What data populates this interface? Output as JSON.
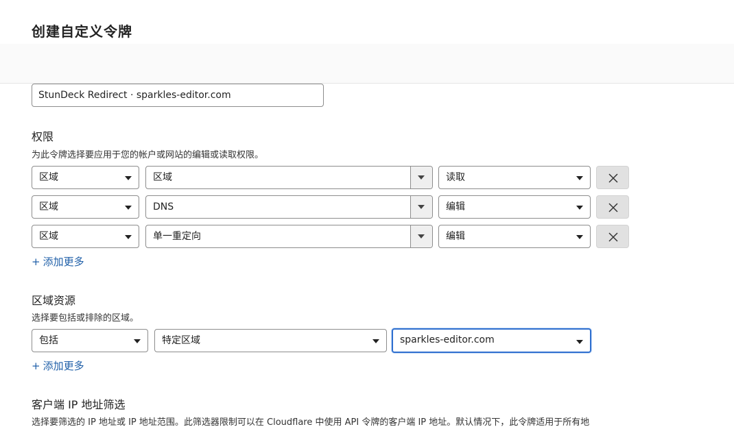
{
  "page": {
    "title": "创建自定义令牌"
  },
  "token_name": {
    "value": "StunDeck Redirect · sparkles-editor.com"
  },
  "permissions": {
    "title": "权限",
    "description": "为此令牌选择要应用于您的帐户或网站的编辑或读取权限。",
    "rows": [
      {
        "scope": "区域",
        "item": "区域",
        "access": "读取"
      },
      {
        "scope": "区域",
        "item": "DNS",
        "access": "编辑"
      },
      {
        "scope": "区域",
        "item": "单一重定向",
        "access": "编辑"
      }
    ],
    "add_more": "添加更多"
  },
  "zone_resources": {
    "title": "区域资源",
    "description": "选择要包括或排除的区域。",
    "include": "包括",
    "type": "特定区域",
    "zone": "sparkles-editor.com",
    "add_more": "添加更多"
  },
  "client_ip": {
    "title": "客户端 IP 地址筛选",
    "description": "选择要筛选的 IP 地址或 IP 地址范围。此筛选器限制可以在 Cloudflare 中使用 API 令牌的客户端 IP 地址。默认情况下，此令牌适用于所有地"
  },
  "colors": {
    "accent": "#2f6fcf",
    "link": "#1f5fa8"
  }
}
